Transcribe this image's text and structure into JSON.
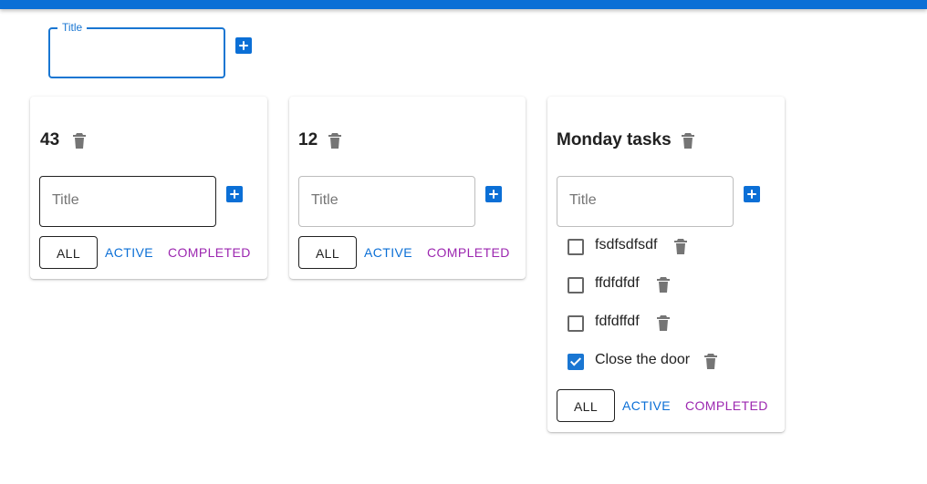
{
  "top_form": {
    "label": "Title",
    "value": ""
  },
  "cards": [
    {
      "title": "43",
      "input_placeholder": "Title",
      "filters": {
        "all": "ALL",
        "active": "ACTIVE",
        "completed": "COMPLETED"
      },
      "tasks": []
    },
    {
      "title": "12",
      "input_placeholder": "Title",
      "filters": {
        "all": "ALL",
        "active": "ACTIVE",
        "completed": "COMPLETED"
      },
      "tasks": []
    },
    {
      "title": "Monday tasks",
      "input_placeholder": "Title",
      "filters": {
        "all": "ALL",
        "active": "ACTIVE",
        "completed": "COMPLETED"
      },
      "tasks": [
        {
          "text": "fsdfsdfsdf",
          "checked": false
        },
        {
          "text": "ffdfdfdf",
          "checked": false
        },
        {
          "text": "fdfdffdf",
          "checked": false
        },
        {
          "text": "Close the door",
          "checked": true
        }
      ]
    }
  ],
  "colors": {
    "primary": "#0b6fd6",
    "secondary": "#9c27b0",
    "icon_gray": "#757575"
  },
  "icons": {
    "add": "plus-box-icon",
    "delete": "trash-icon",
    "checkbox": "checkbox-icon"
  }
}
